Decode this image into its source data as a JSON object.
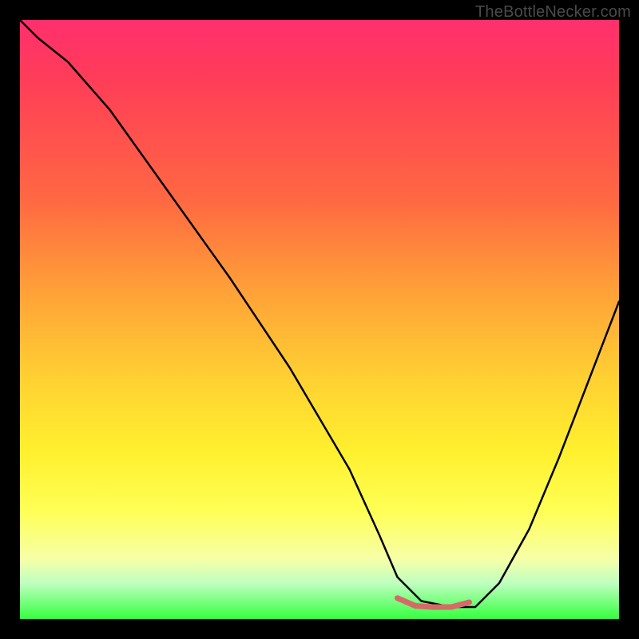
{
  "attribution": "TheBottleNecker.com",
  "colors": {
    "background": "#000000",
    "curve": "#000000",
    "valley_highlight": "#d66a68",
    "gradient_top": "#ff2f6e",
    "gradient_bottom": "#35ff3f"
  },
  "chart_data": {
    "type": "line",
    "title": "",
    "xlabel": "",
    "ylabel": "",
    "xlim": [
      0,
      100
    ],
    "ylim": [
      0,
      100
    ],
    "grid": false,
    "legend": false,
    "annotations": [],
    "series": [
      {
        "name": "curve",
        "x": [
          0,
          3,
          8,
          15,
          25,
          35,
          45,
          55,
          60,
          63,
          67,
          72,
          76,
          80,
          85,
          90,
          95,
          100
        ],
        "y": [
          100,
          97,
          93,
          85,
          71,
          57,
          42,
          25,
          14,
          7,
          3,
          2,
          2,
          6,
          15,
          27,
          40,
          53
        ]
      },
      {
        "name": "valley-highlight",
        "x": [
          63,
          66,
          69,
          72,
          75
        ],
        "y": [
          3.5,
          2.2,
          2.0,
          2.0,
          2.8
        ]
      }
    ],
    "notes": "Background is a vertical color gradient (red→orange→yellow→green) within a black frame; y-values estimated from gridless image."
  }
}
